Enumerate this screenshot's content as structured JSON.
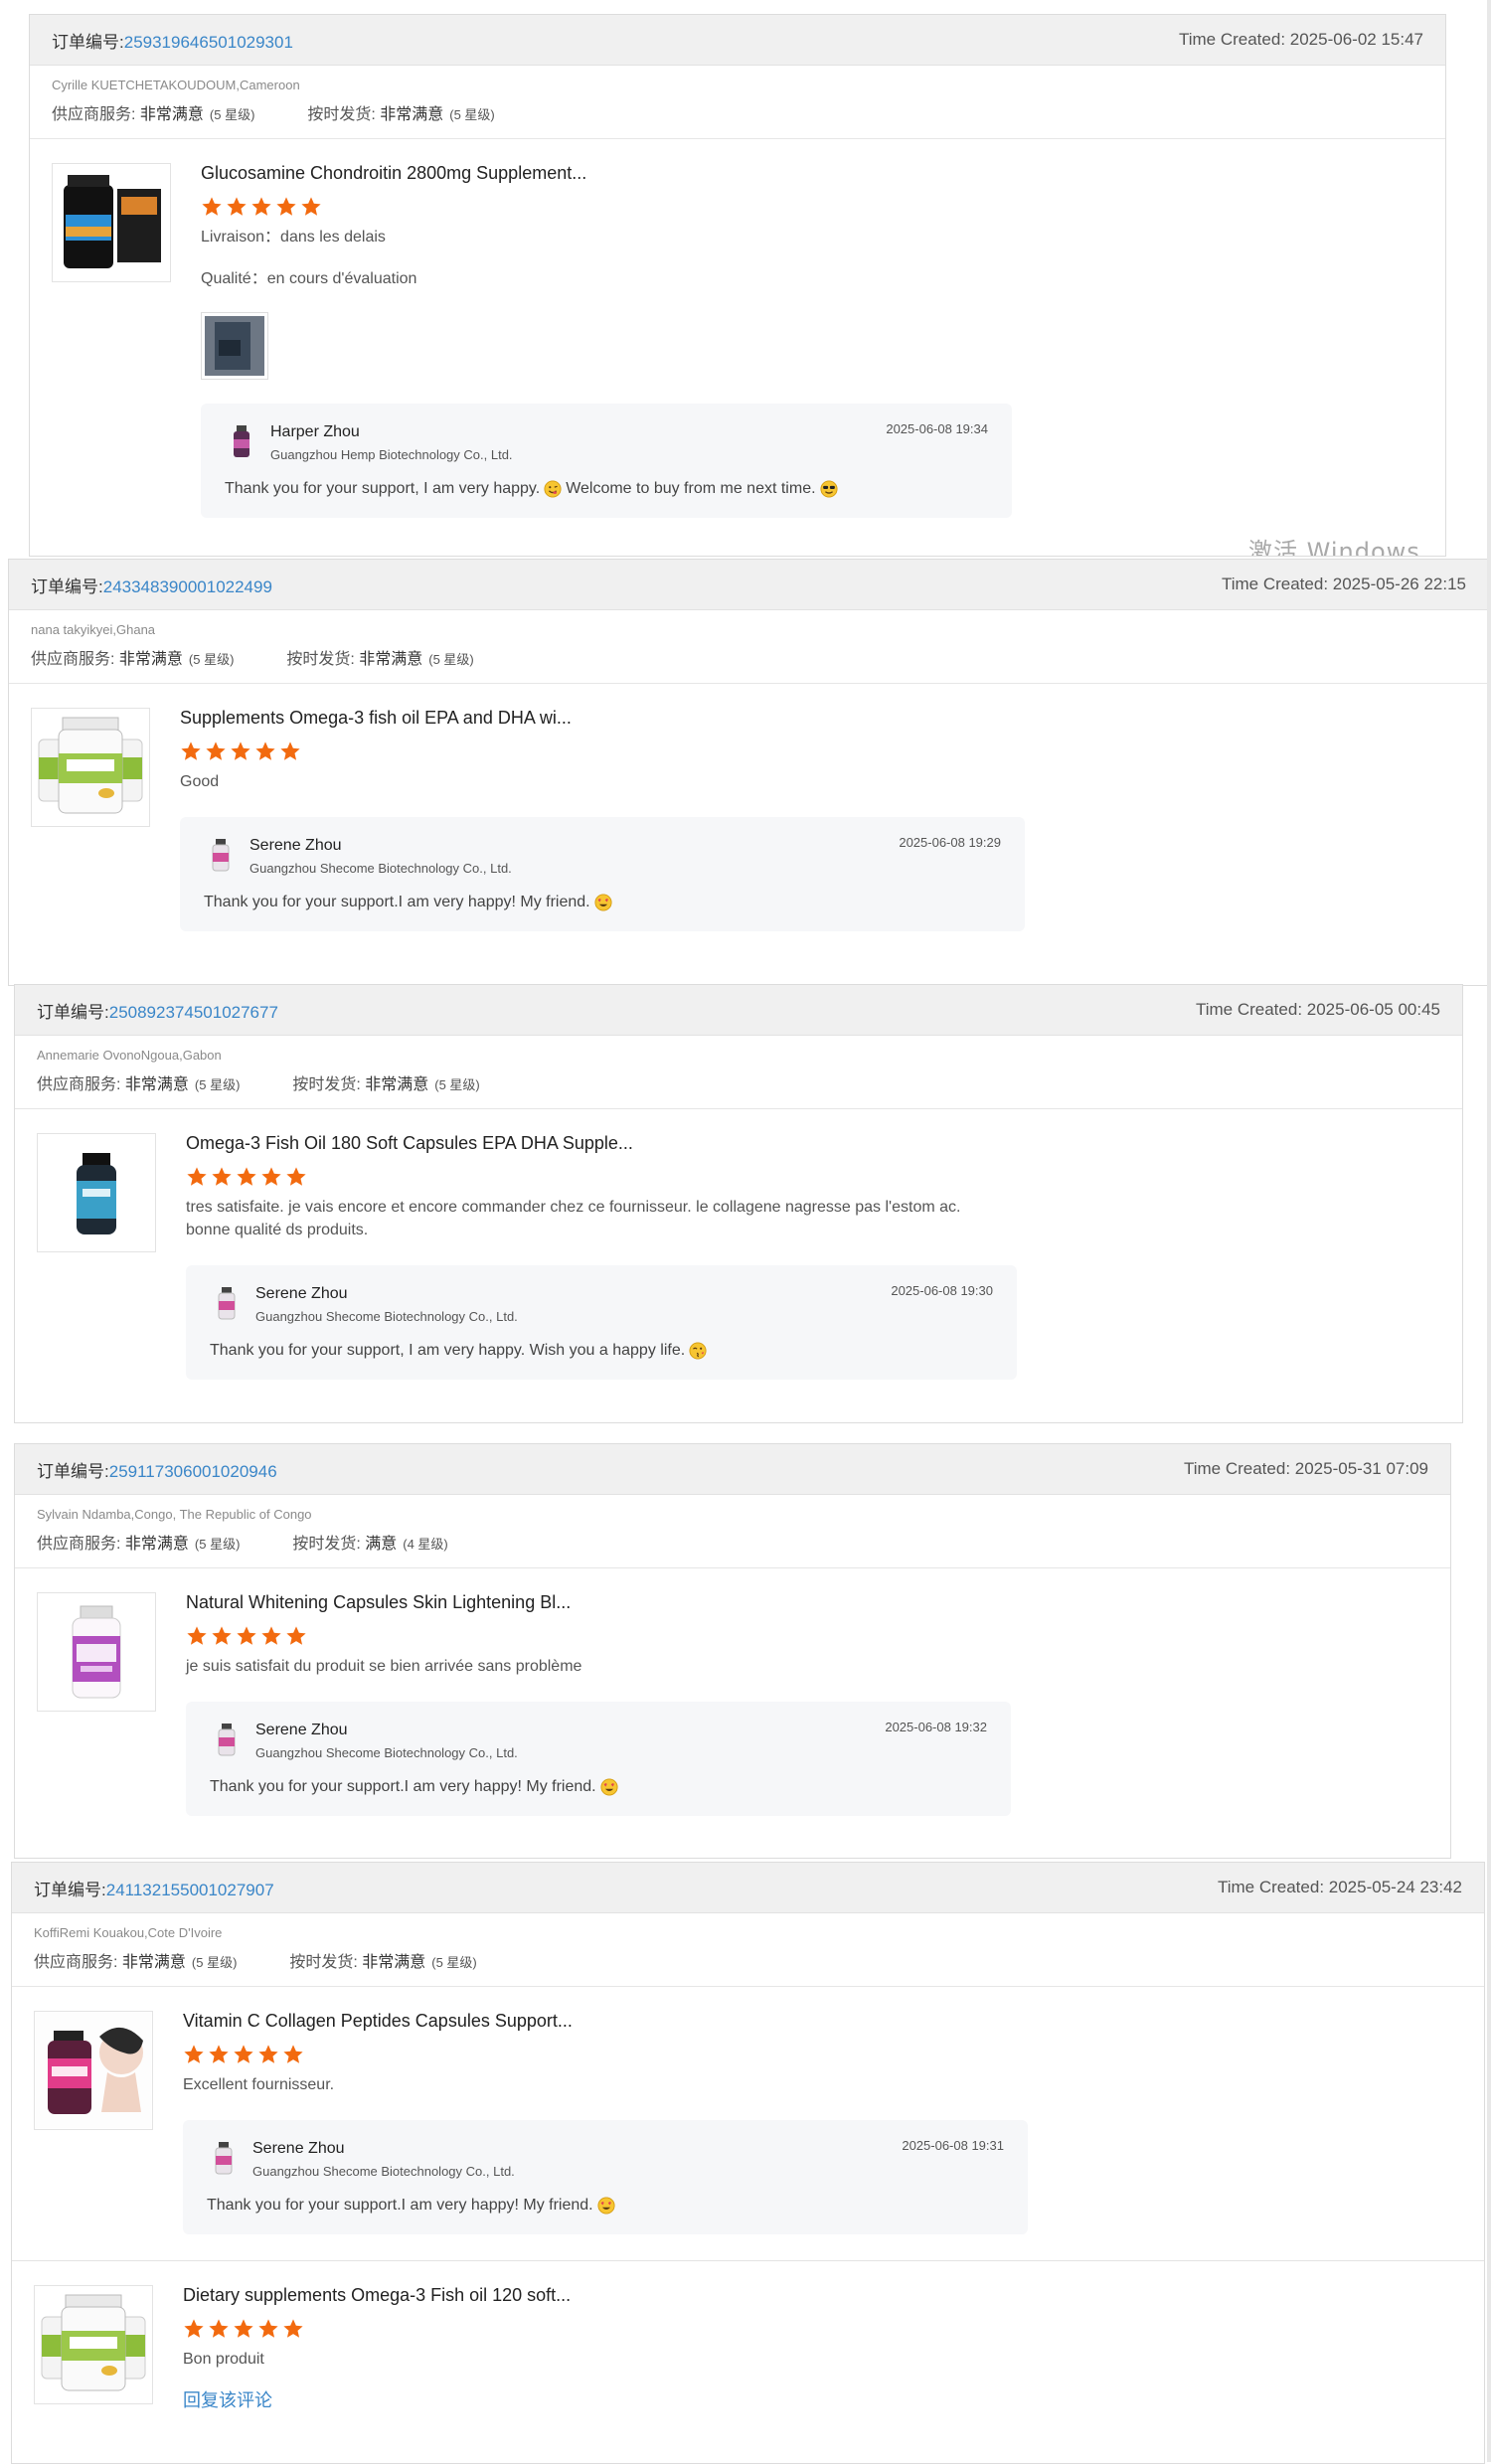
{
  "labels": {
    "order_no": "订单编号:",
    "time_created": "Time Created: ",
    "supplier_service": "供应商服务: ",
    "on_time_shipping": "按时发货: ",
    "delivery": "Livraison：",
    "quality": "Qualité：",
    "reply_link": "回复该评论"
  },
  "watermark": "激活 Windows",
  "colors": {
    "link": "#3a86c8",
    "star": "#f26a0f",
    "reply_bg": "#f6f7f9",
    "head_bg": "#f0f0f0"
  },
  "rating_scale": {
    "max_stars": 5
  },
  "orders": [
    {
      "order_number": "259319646501029301",
      "time_created": "2025-06-02 15:47",
      "buyer": "Cyrille KUETCHETAKOUDOUM,Cameroon",
      "supplier_service": {
        "value": "非常满意",
        "stars": "(5 星级)"
      },
      "shipping": {
        "value": "非常满意",
        "stars": "(5 星级)"
      },
      "items": [
        {
          "title": "Glucosamine Chondroitin 2800mg Supplement...",
          "rating": 5,
          "delivery": "dans les delais",
          "quality": "en cours d'évaluation",
          "thumb_icon": "glucosamine-bottle-image",
          "reply": {
            "name": "Harper Zhou",
            "company": "Guangzhou Hemp Biotechnology Co., Ltd.",
            "date": "2025-06-08 19:34",
            "text_a": "Thank you for your support, I am very happy.",
            "text_b": "Welcome to buy from me next time.",
            "emoji_a": "yum-emoji",
            "emoji_b": "cool-emoji"
          }
        }
      ]
    },
    {
      "order_number": "243348390001022499",
      "time_created": "2025-05-26 22:15",
      "buyer": "nana takyikyei,Ghana",
      "supplier_service": {
        "value": "非常满意",
        "stars": "(5 星级)"
      },
      "shipping": {
        "value": "非常满意",
        "stars": "(5 星级)"
      },
      "items": [
        {
          "title": "Supplements Omega-3 fish oil EPA and DHA wi...",
          "rating": 5,
          "text": "Good",
          "thumb_icon": "omega3-bottles-image",
          "reply": {
            "name": "Serene Zhou",
            "company": "Guangzhou Shecome Biotechnology Co., Ltd.",
            "date": "2025-06-08 19:29",
            "text_a": "Thank you for your support.I am very happy! My friend.",
            "emoji_a": "heart-eyes-emoji"
          }
        }
      ]
    },
    {
      "order_number": "250892374501027677",
      "time_created": "2025-06-05 00:45",
      "buyer": "Annemarie OvonoNgoua,Gabon",
      "supplier_service": {
        "value": "非常满意",
        "stars": "(5 星级)"
      },
      "shipping": {
        "value": "非常满意",
        "stars": "(5 星级)"
      },
      "items": [
        {
          "title": "Omega-3 Fish Oil 180 Soft Capsules EPA DHA Supple...",
          "rating": 5,
          "text": "tres satisfaite. je vais encore et encore commander chez ce fournisseur. le collagene nagresse pas l'estom ac. bonne qualité ds produits.",
          "thumb_icon": "fish-oil-bottle-image",
          "reply": {
            "name": "Serene Zhou",
            "company": "Guangzhou Shecome Biotechnology Co., Ltd.",
            "date": "2025-06-08 19:30",
            "text_a": "Thank you for your support, I am very happy. Wish you a happy life.",
            "emoji_a": "kiss-emoji"
          }
        }
      ]
    },
    {
      "order_number": "259117306001020946",
      "time_created": "2025-05-31 07:09",
      "buyer": "Sylvain Ndamba,Congo, The Republic of Congo",
      "supplier_service": {
        "value": "非常满意",
        "stars": "(5 星级)"
      },
      "shipping": {
        "value": "满意",
        "stars": "(4 星级)"
      },
      "items": [
        {
          "title": "Natural Whitening Capsules Skin Lightening Bl...",
          "rating": 5,
          "text": "je suis satisfait du produit se bien arrivée sans problème",
          "thumb_icon": "skin-bottle-image",
          "reply": {
            "name": "Serene Zhou",
            "company": "Guangzhou Shecome Biotechnology Co., Ltd.",
            "date": "2025-06-08 19:32",
            "text_a": "Thank you for your support.I am very happy! My friend.",
            "emoji_a": "heart-eyes-emoji"
          }
        }
      ]
    },
    {
      "order_number": "241132155001027907",
      "time_created": "2025-05-24 23:42",
      "buyer": "KoffiRemi Kouakou,Cote D'Ivoire",
      "supplier_service": {
        "value": "非常满意",
        "stars": "(5 星级)"
      },
      "shipping": {
        "value": "非常满意",
        "stars": "(5 星级)"
      },
      "items": [
        {
          "title": "Vitamin C Collagen Peptides Capsules Support...",
          "rating": 5,
          "text": "Excellent fournisseur.",
          "thumb_icon": "collagen-bottle-image",
          "reply": {
            "name": "Serene Zhou",
            "company": "Guangzhou Shecome Biotechnology Co., Ltd.",
            "date": "2025-06-08 19:31",
            "text_a": "Thank you for your support.I am very happy! My friend.",
            "emoji_a": "heart-eyes-emoji"
          }
        },
        {
          "title": "Dietary supplements Omega-3 Fish oil 120 soft...",
          "rating": 5,
          "text": "Bon produit",
          "thumb_icon": "omega3-bottles-image"
        }
      ]
    }
  ]
}
